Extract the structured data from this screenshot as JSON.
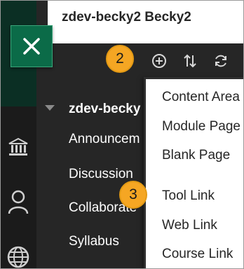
{
  "header": {
    "course_title": "zdev-becky2 Becky2"
  },
  "close_button": {
    "icon": "close-icon"
  },
  "toolbar": {
    "add_icon": "plus-circle-icon",
    "reorder_icon": "reorder-arrows-icon",
    "refresh_icon": "refresh-icon"
  },
  "callouts": {
    "step2": "2",
    "step3": "3"
  },
  "course_menu": {
    "root": "zdev-becky",
    "items": [
      "Announcem",
      "Discussion",
      "Collaborate",
      "Syllabus"
    ]
  },
  "add_menu": {
    "items": [
      "Content Area",
      "Module Page",
      "Blank Page",
      "Tool Link",
      "Web Link",
      "Course Link"
    ]
  },
  "rail_icons": [
    "institution-icon",
    "user-icon",
    "globe-icon"
  ],
  "colors": {
    "callout": "#f5a623",
    "close_button": "#0b6b48",
    "panel": "#262626"
  }
}
